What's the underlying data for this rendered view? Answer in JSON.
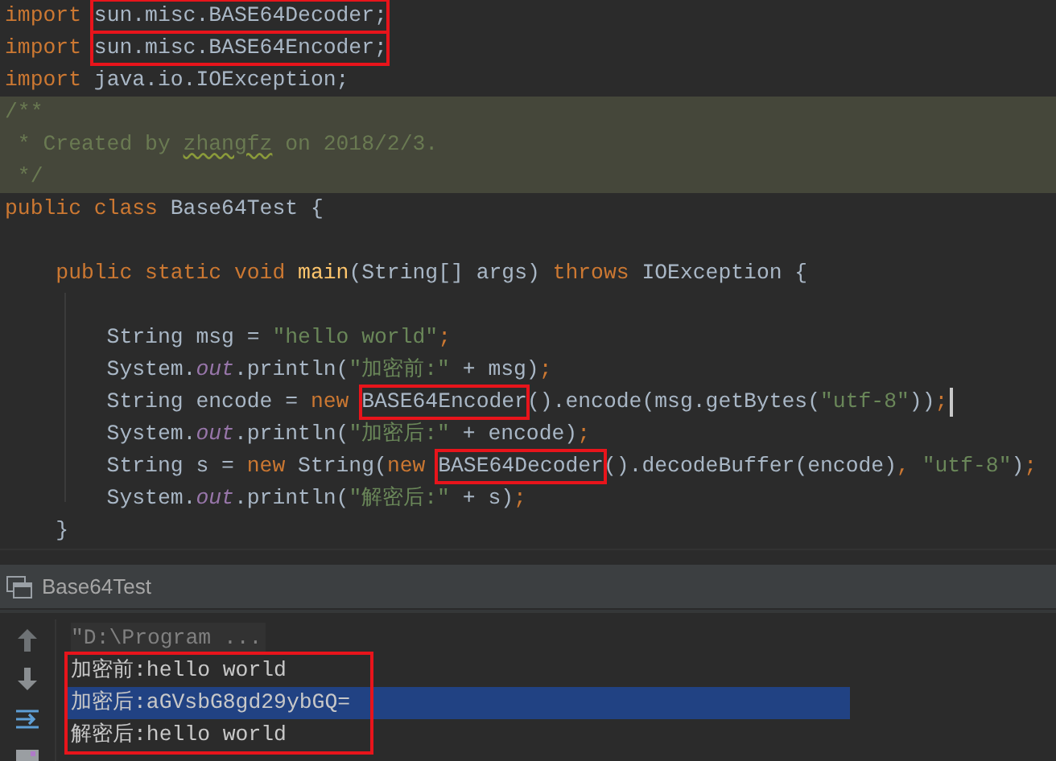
{
  "editor": {
    "lines": [
      {
        "kind": "code",
        "caret": false,
        "segments": [
          {
            "boxed": false,
            "tokens": [
              {
                "text": "import ",
                "kind": "kw"
              }
            ]
          },
          {
            "boxed": true,
            "tokens": [
              {
                "text": "sun.misc.BASE64Decoder;",
                "kind": "plain"
              }
            ]
          }
        ]
      },
      {
        "kind": "code",
        "caret": false,
        "segments": [
          {
            "boxed": false,
            "tokens": [
              {
                "text": "import ",
                "kind": "kw"
              }
            ]
          },
          {
            "boxed": true,
            "tokens": [
              {
                "text": "sun.misc.BASE64Encoder;",
                "kind": "plain"
              }
            ]
          }
        ]
      },
      {
        "kind": "code",
        "caret": false,
        "segments": [
          {
            "boxed": false,
            "tokens": [
              {
                "text": "import ",
                "kind": "kw"
              },
              {
                "text": "java.io.IOException;",
                "kind": "plain"
              }
            ]
          }
        ]
      },
      {
        "kind": "doc",
        "caret": false,
        "segments": [
          {
            "boxed": false,
            "tokens": [
              {
                "text": "/**",
                "kind": "comment"
              }
            ]
          }
        ]
      },
      {
        "kind": "doc",
        "caret": false,
        "segments": [
          {
            "boxed": false,
            "tokens": [
              {
                "text": " * Created by ",
                "kind": "comment"
              },
              {
                "text": "zhangfz",
                "kind": "typo"
              },
              {
                "text": " on 2018/2/3.",
                "kind": "comment"
              }
            ]
          }
        ]
      },
      {
        "kind": "doc",
        "caret": false,
        "segments": [
          {
            "boxed": false,
            "tokens": [
              {
                "text": " */",
                "kind": "comment"
              }
            ]
          }
        ]
      },
      {
        "kind": "code",
        "caret": false,
        "segments": [
          {
            "boxed": false,
            "tokens": [
              {
                "text": "public class ",
                "kind": "kw"
              },
              {
                "text": "Base64Test {",
                "kind": "plain"
              }
            ]
          }
        ]
      },
      {
        "kind": "blank",
        "caret": false
      },
      {
        "kind": "code",
        "caret": false,
        "segments": [
          {
            "boxed": false,
            "tokens": [
              {
                "text": "    public static void ",
                "kind": "kw"
              },
              {
                "text": "main",
                "kind": "fn"
              },
              {
                "text": "(String[] args) ",
                "kind": "plain"
              },
              {
                "text": "throws ",
                "kind": "kw"
              },
              {
                "text": "IOException {",
                "kind": "plain"
              }
            ]
          }
        ]
      },
      {
        "kind": "blank",
        "caret": false
      },
      {
        "kind": "code",
        "caret": false,
        "segments": [
          {
            "boxed": false,
            "tokens": [
              {
                "text": "        String msg = ",
                "kind": "plain"
              },
              {
                "text": "\"hello world\"",
                "kind": "str"
              },
              {
                "text": ";",
                "kind": "kw"
              }
            ]
          }
        ]
      },
      {
        "kind": "code",
        "caret": false,
        "segments": [
          {
            "boxed": false,
            "tokens": [
              {
                "text": "        System.",
                "kind": "plain"
              },
              {
                "text": "out",
                "kind": "field"
              },
              {
                "text": ".println(",
                "kind": "plain"
              },
              {
                "text": "\"加密前:\"",
                "kind": "str"
              },
              {
                "text": " + msg)",
                "kind": "plain"
              },
              {
                "text": ";",
                "kind": "kw"
              }
            ]
          }
        ]
      },
      {
        "kind": "code",
        "caret": true,
        "segments": [
          {
            "boxed": false,
            "tokens": [
              {
                "text": "        String encode = ",
                "kind": "plain"
              },
              {
                "text": "new ",
                "kind": "kw"
              }
            ]
          },
          {
            "boxed": true,
            "tokens": [
              {
                "text": "BASE64Encoder",
                "kind": "plain"
              }
            ]
          },
          {
            "boxed": false,
            "tokens": [
              {
                "text": "().encode(msg.getBytes(",
                "kind": "plain"
              },
              {
                "text": "\"utf-8\"",
                "kind": "str"
              },
              {
                "text": "))",
                "kind": "plain"
              },
              {
                "text": ";",
                "kind": "kw"
              }
            ]
          }
        ]
      },
      {
        "kind": "code",
        "caret": false,
        "segments": [
          {
            "boxed": false,
            "tokens": [
              {
                "text": "        System.",
                "kind": "plain"
              },
              {
                "text": "out",
                "kind": "field"
              },
              {
                "text": ".println(",
                "kind": "plain"
              },
              {
                "text": "\"加密后:\"",
                "kind": "str"
              },
              {
                "text": " + encode)",
                "kind": "plain"
              },
              {
                "text": ";",
                "kind": "kw"
              }
            ]
          }
        ]
      },
      {
        "kind": "code",
        "caret": false,
        "segments": [
          {
            "boxed": false,
            "tokens": [
              {
                "text": "        String s = ",
                "kind": "plain"
              },
              {
                "text": "new ",
                "kind": "kw"
              },
              {
                "text": "String(",
                "kind": "plain"
              },
              {
                "text": "new ",
                "kind": "kw"
              }
            ]
          },
          {
            "boxed": true,
            "tokens": [
              {
                "text": "BASE64Decoder",
                "kind": "plain"
              }
            ]
          },
          {
            "boxed": false,
            "tokens": [
              {
                "text": "().decodeBuffer(encode)",
                "kind": "plain"
              },
              {
                "text": ", ",
                "kind": "kw"
              },
              {
                "text": "\"utf-8\"",
                "kind": "str"
              },
              {
                "text": ")",
                "kind": "plain"
              },
              {
                "text": ";",
                "kind": "kw"
              }
            ]
          }
        ]
      },
      {
        "kind": "code",
        "caret": false,
        "segments": [
          {
            "boxed": false,
            "tokens": [
              {
                "text": "        System.",
                "kind": "plain"
              },
              {
                "text": "out",
                "kind": "field"
              },
              {
                "text": ".println(",
                "kind": "plain"
              },
              {
                "text": "\"解密后:\"",
                "kind": "str"
              },
              {
                "text": " + s)",
                "kind": "plain"
              },
              {
                "text": ";",
                "kind": "kw"
              }
            ]
          }
        ]
      },
      {
        "kind": "code",
        "caret": false,
        "segments": [
          {
            "boxed": false,
            "tokens": [
              {
                "text": "    }",
                "kind": "plain"
              }
            ]
          }
        ]
      }
    ]
  },
  "run_panel": {
    "title": "Base64Test",
    "command": "\"D:\\Program ...",
    "output": {
      "boxed": true,
      "lines": [
        {
          "text": "加密前:hello world",
          "selected": false
        },
        {
          "text": "加密后:aGVsbG8gd29ybGQ=",
          "selected": true
        },
        {
          "text": "解密后:hello world",
          "selected": false
        }
      ]
    }
  }
}
